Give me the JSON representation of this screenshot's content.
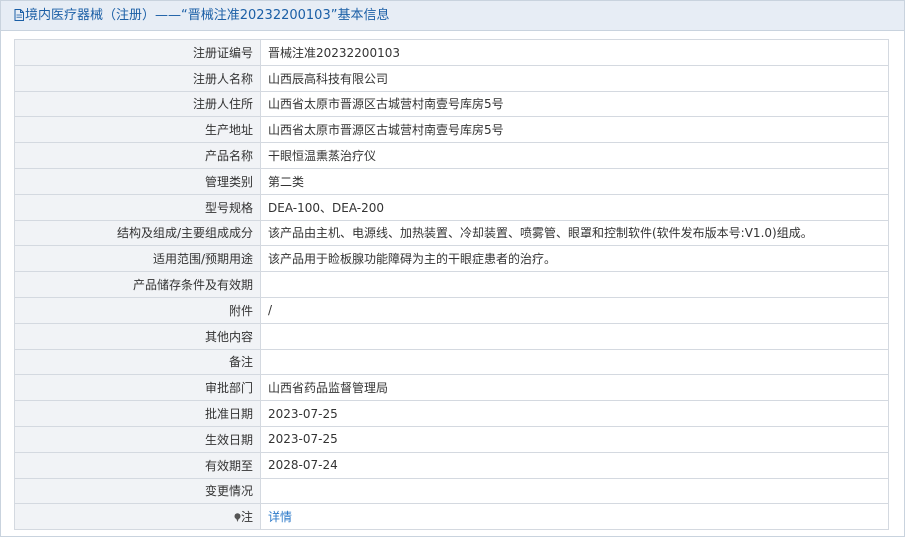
{
  "header": {
    "icon": "document-icon",
    "title": "境内医疗器械（注册）——“晋械注准20232200103”基本信息"
  },
  "rows": [
    {
      "label": "注册证编号",
      "value": "晋械注准20232200103"
    },
    {
      "label": "注册人名称",
      "value": "山西辰高科技有限公司"
    },
    {
      "label": "注册人住所",
      "value": "山西省太原市晋源区古城营村南壹号库房5号"
    },
    {
      "label": "生产地址",
      "value": "山西省太原市晋源区古城营村南壹号库房5号"
    },
    {
      "label": "产品名称",
      "value": "干眼恒温熏蒸治疗仪"
    },
    {
      "label": "管理类别",
      "value": "第二类"
    },
    {
      "label": "型号规格",
      "value": "DEA-100、DEA-200"
    },
    {
      "label": "结构及组成/主要组成成分",
      "value": "该产品由主机、电源线、加热装置、冷却装置、喷雾管、眼罩和控制软件(软件发布版本号:V1.0)组成。"
    },
    {
      "label": "适用范围/预期用途",
      "value": "该产品用于睑板腺功能障碍为主的干眼症患者的治疗。"
    },
    {
      "label": "产品储存条件及有效期",
      "value": ""
    },
    {
      "label": "附件",
      "value": "/"
    },
    {
      "label": "其他内容",
      "value": ""
    },
    {
      "label": "备注",
      "value": ""
    },
    {
      "label": "审批部门",
      "value": "山西省药品监督管理局"
    },
    {
      "label": "批准日期",
      "value": "2023-07-25"
    },
    {
      "label": "生效日期",
      "value": "2023-07-25"
    },
    {
      "label": "有效期至",
      "value": "2028-07-24"
    },
    {
      "label": "变更情况",
      "value": ""
    }
  ],
  "note_row": {
    "icon": "pin-icon",
    "label": "注",
    "link": "详情"
  }
}
